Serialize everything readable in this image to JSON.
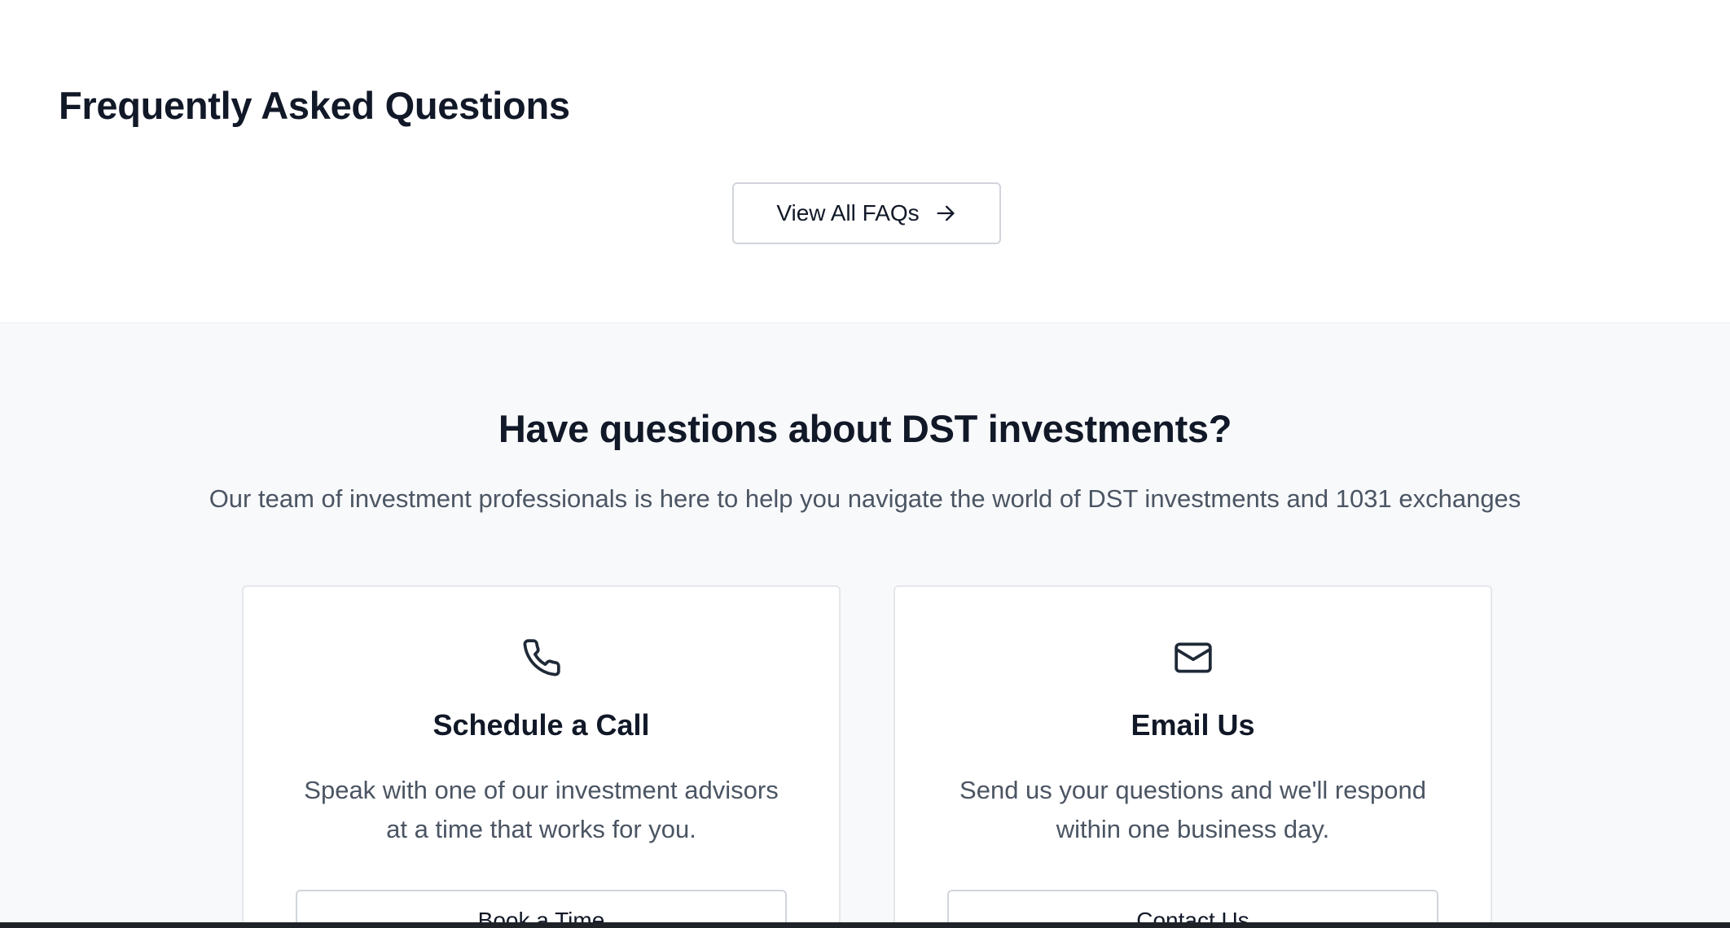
{
  "faq": {
    "title": "Frequently Asked Questions",
    "view_all_label": "View All FAQs",
    "view_all_icon": "arrow-right-icon"
  },
  "contact": {
    "heading": "Have questions about DST investments?",
    "subheading": "Our team of investment professionals is here to help you navigate the world of DST investments and 1031 exchanges",
    "cards": [
      {
        "icon": "phone-icon",
        "title": "Schedule a Call",
        "text": "Speak with one of our investment advisors at a time that works for you.",
        "button_label": "Book a Time"
      },
      {
        "icon": "mail-icon",
        "title": "Email Us",
        "text": "Send us your questions and we'll respond within one business day.",
        "button_label": "Contact Us"
      }
    ]
  },
  "colors": {
    "heading": "#111827",
    "body_text": "#4b5563",
    "section_bg": "#f8f9fb",
    "border": "#d1d5db"
  }
}
